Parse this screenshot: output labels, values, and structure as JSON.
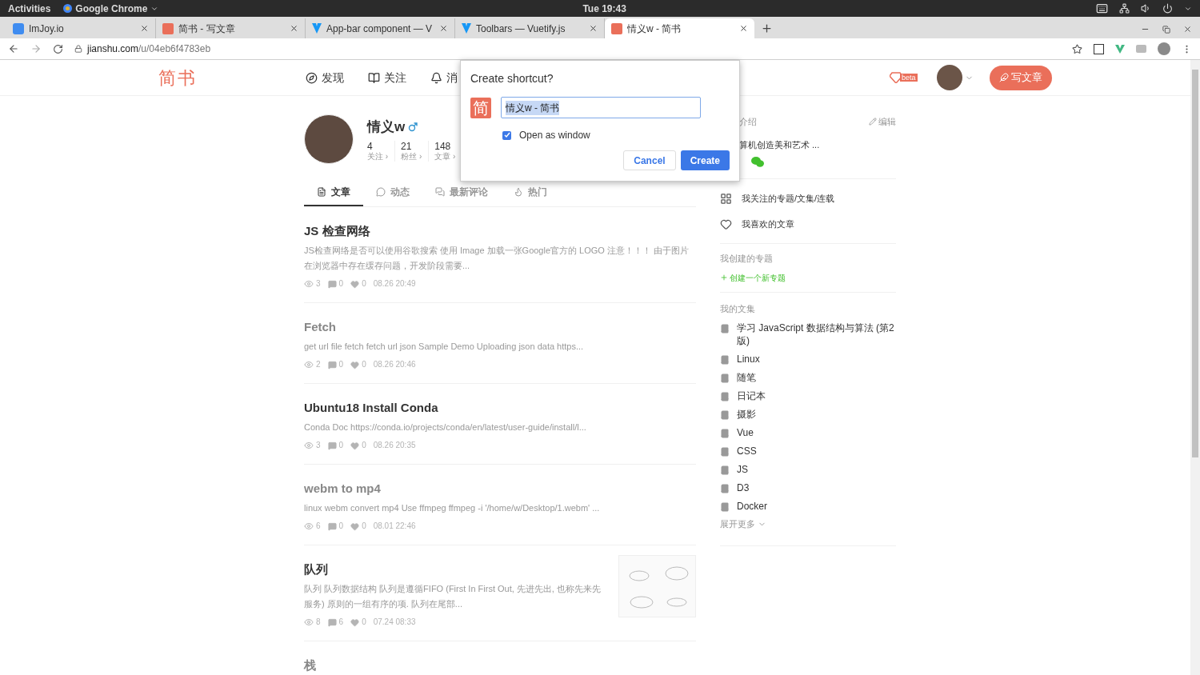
{
  "system_bar": {
    "activities": "Activities",
    "app": "Google Chrome",
    "clock": "Tue 19:43"
  },
  "browser": {
    "tabs": [
      {
        "title": "ImJoy.io",
        "kind": "imjoy",
        "selected": false
      },
      {
        "title": "简书 - 写文章",
        "kind": "jianshu",
        "selected": false
      },
      {
        "title": "App-bar component — V",
        "kind": "vuetify",
        "selected": false
      },
      {
        "title": "Toolbars — Vuetify.js",
        "kind": "vuetify",
        "selected": false
      },
      {
        "title": "情义w - 简书",
        "kind": "jianshu",
        "selected": true
      }
    ],
    "url_host": "jianshu.com",
    "url_path": "/u/04eb6f4783eb"
  },
  "site_header": {
    "logo": "简书",
    "nav": [
      "发现",
      "关注",
      "消"
    ],
    "beta": "beta",
    "write_button": "写文章"
  },
  "profile": {
    "name": "情义w",
    "stats": [
      {
        "value": "4",
        "label": "关注 ›"
      },
      {
        "value": "21",
        "label": "粉丝 ›"
      },
      {
        "value": "148",
        "label": "文章 ›"
      }
    ]
  },
  "content_tabs": [
    {
      "label": "文章",
      "selected": true
    },
    {
      "label": "动态",
      "selected": false
    },
    {
      "label": "最新评论",
      "selected": false
    },
    {
      "label": "热门",
      "selected": false
    }
  ],
  "articles": [
    {
      "title": "JS 检查网络",
      "summary": "JS检查网络是否可以使用谷歌搜索 使用 Image 加载一张Google官方的 LOGO 注意！！！ 由于图片在浏览器中存在缓存问题，开发阶段需要...",
      "visited": false,
      "views": "3",
      "comments": "0",
      "likes": "0",
      "time": "08.26 20:49",
      "thumbnail": false
    },
    {
      "title": "Fetch",
      "summary": "get url file fetch fetch url json Sample Demo Uploading json data https...",
      "visited": true,
      "views": "2",
      "comments": "0",
      "likes": "0",
      "time": "08.26 20:46",
      "thumbnail": false
    },
    {
      "title": "Ubuntu18 Install Conda",
      "summary": "Conda Doc https://conda.io/projects/conda/en/latest/user-guide/install/l...",
      "visited": false,
      "views": "3",
      "comments": "0",
      "likes": "0",
      "time": "08.26 20:35",
      "thumbnail": false
    },
    {
      "title": "webm to mp4",
      "summary": "linux webm convert mp4 Use ffmpeg ffmpeg -i '/home/w/Desktop/1.webm' ...",
      "visited": true,
      "views": "6",
      "comments": "0",
      "likes": "0",
      "time": "08.01 22:46",
      "thumbnail": false
    },
    {
      "title": "队列",
      "summary": "队列 队列数据结构 队列是遵循FIFO (First In First Out, 先进先出, 也称先来先服务) 原则的一组有序的项. 队列在尾部...",
      "visited": false,
      "views": "8",
      "comments": "6",
      "likes": "0",
      "time": "07.24 08:33",
      "thumbnail": true
    },
    {
      "title": "栈",
      "visited": true,
      "thumbnail": false
    }
  ],
  "sidebar": {
    "intro_label": "介绍",
    "edit": "编辑",
    "intro_text": "算机创造美和艺术 ...",
    "links": [
      "我关注的专题/文集/连载",
      "我喜欢的文章"
    ],
    "topics_label": "我创建的专题",
    "new_topic": "创建一个新专题",
    "notebooks_label": "我的文集",
    "notebooks": [
      "学习 JavaScript 数据结构与算法 (第2版)",
      "Linux",
      "随笔",
      "日记本",
      "摄影",
      "Vue",
      "CSS",
      "JS",
      "D3",
      "Docker"
    ],
    "more": "展开更多"
  },
  "dialog": {
    "title": "Create shortcut?",
    "icon_text": "简",
    "name_value": "情义w - 简书",
    "open_as_window": {
      "label": "Open as window",
      "checked": true
    },
    "buttons": [
      {
        "label": "Cancel",
        "kind": "secondary"
      },
      {
        "label": "Create",
        "kind": "primary"
      }
    ]
  }
}
